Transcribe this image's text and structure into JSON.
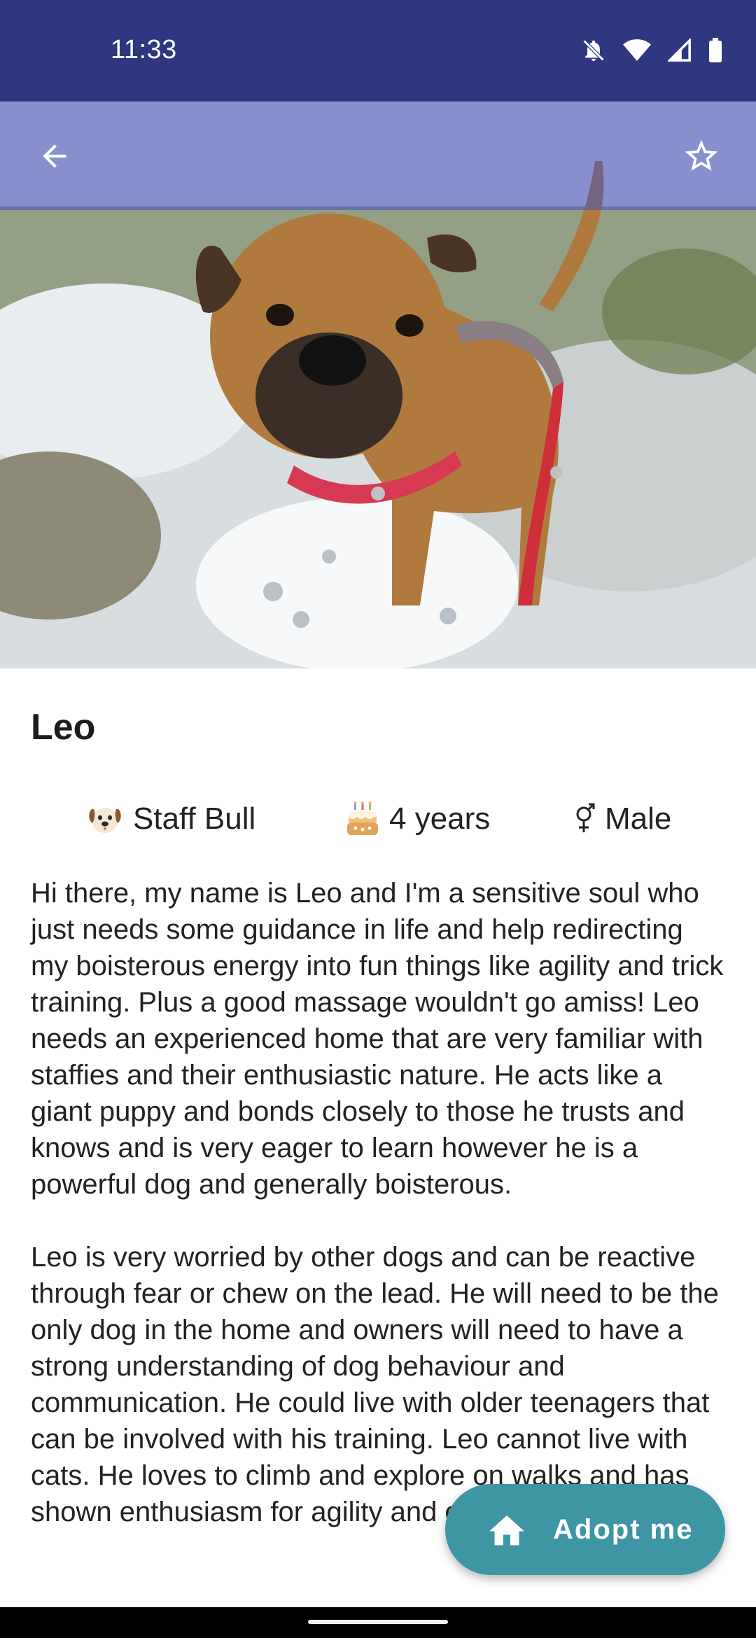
{
  "status_bar": {
    "time": "11:33",
    "icons": [
      "notifications-off-icon",
      "wifi-icon",
      "signal-icon",
      "battery-icon"
    ]
  },
  "toolbar": {
    "back_icon": "arrow-back-icon",
    "favorite_icon": "star-outline-icon"
  },
  "pet": {
    "name": "Leo",
    "photo_description": "tan dog with red harness standing on snowy grass",
    "attributes": {
      "breed": {
        "icon": "dog-face-emoji",
        "label": "Staff Bull"
      },
      "age": {
        "icon": "birthday-cake-emoji",
        "label": "4 years"
      },
      "sex": {
        "icon": "gender-symbol-icon",
        "label": "Male"
      }
    },
    "description": [
      "Hi there, my name is Leo and I'm a sensitive soul who just needs some guidance in life and help redirecting my boisterous energy into fun things like agility and trick training. Plus a good massage wouldn't go amiss! Leo needs an experienced home that are very familiar with staffies and their enthusiastic nature. He acts like a giant puppy and bonds closely to those he trusts and knows and is very eager to learn however he is a powerful dog and generally boisterous.",
      "Leo is very worried by other dogs and can be reactive through fear or chew on the lead. He will need to be the only dog in the home and owners will need to have a strong understanding of dog behaviour and communication. He could live with older teenagers that can be involved with his training. Leo cannot live with cats. He loves to climb and explore on walks and has shown enthusiasm for agility and eagerness to wait on"
    ]
  },
  "adopt_button": {
    "label": "Adopt me",
    "icon": "home-icon",
    "color": "#3e95a3"
  },
  "colors": {
    "status_bar": "#2f3780",
    "toolbar_overlay": "#4650be"
  }
}
